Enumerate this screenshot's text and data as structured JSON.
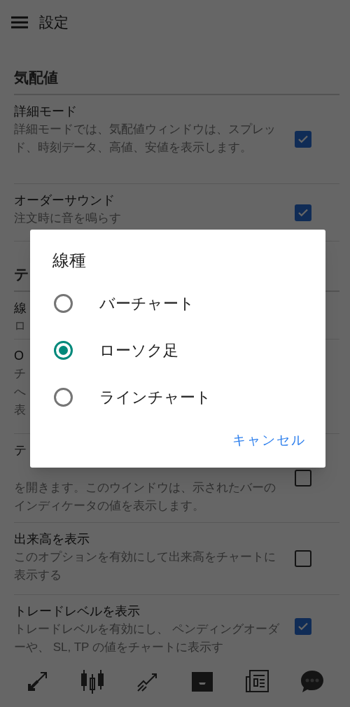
{
  "header": {
    "title": "設定"
  },
  "sections": [
    {
      "title": "気配値",
      "rows": [
        {
          "title": "詳細モード",
          "description": "詳細モードでは、気配値ウィンドウは、スプレッド、時刻データ、高値、安値を表示します。",
          "checked": true
        },
        {
          "title": "オーダーサウンド",
          "description": "注文時に音を鳴らす",
          "checked": true
        }
      ]
    },
    {
      "title": "テ",
      "rows": [
        {
          "title": "線",
          "description": "ロ"
        },
        {
          "title": "O",
          "description": "チへ表"
        },
        {
          "title": "テ",
          "description": "を開きます。このウインドウは、示されたバーのインディケータの値を表示します。",
          "checked": false
        },
        {
          "title": "出来高を表示",
          "description": "このオプションを有効にして出来高をチャートに表示する",
          "checked": false
        },
        {
          "title": "トレードレベルを表示",
          "description": "トレードレベルを有効にし、 ペンディングオーダーや、 SL, TP の値をチャートに表示す",
          "checked": true
        }
      ]
    }
  ],
  "dialog": {
    "title": "線種",
    "options": [
      {
        "label": "バーチャート",
        "selected": false
      },
      {
        "label": "ローソク足",
        "selected": true
      },
      {
        "label": "ラインチャート",
        "selected": false
      }
    ],
    "cancel": "キャンセル"
  }
}
